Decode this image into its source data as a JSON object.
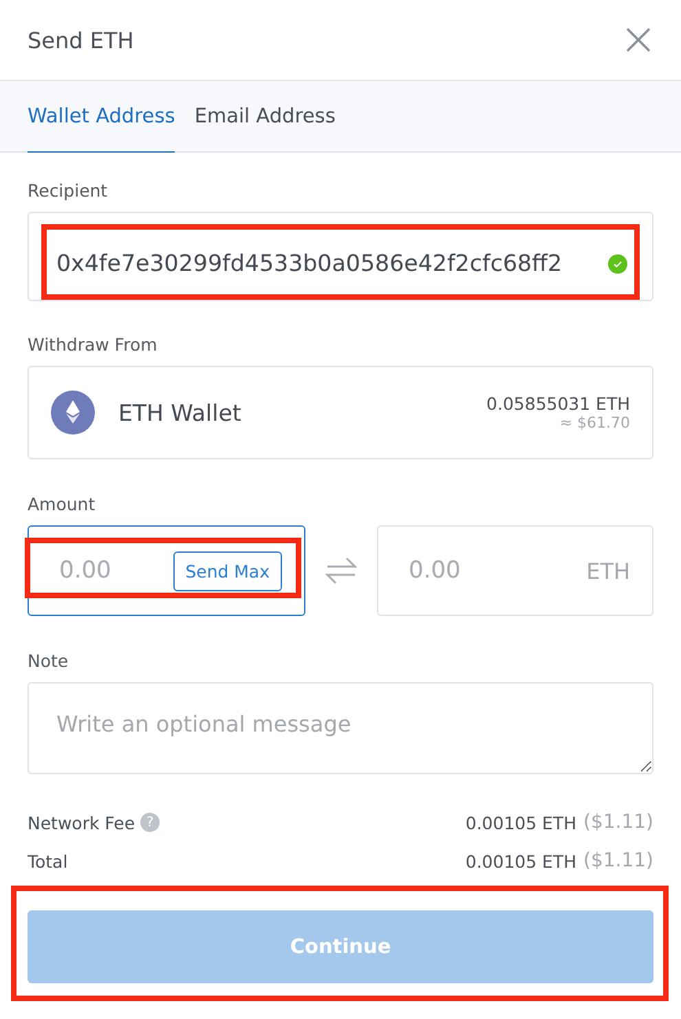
{
  "window": {
    "title": "Send ETH"
  },
  "tabs": [
    {
      "label": "Wallet Address",
      "selected": true
    },
    {
      "label": "Email Address",
      "selected": false
    }
  ],
  "recipient": {
    "label": "Recipient",
    "value": "0x4fe7e30299fd4533b0a0586e42f2cfc68ff2",
    "valid": true,
    "highlighted": true
  },
  "withdraw_from": {
    "label": "Withdraw From",
    "wallet": "ETH Wallet",
    "balance": "0.05855031 ETH",
    "fiat": "≈ $61.70"
  },
  "amount": {
    "label": "Amount",
    "placeholder": "0.00",
    "send_max": "Send Max",
    "highlighted": true,
    "converted_placeholder": "0.00",
    "unit": "ETH"
  },
  "note": {
    "label": "Note",
    "placeholder": "Write an optional message"
  },
  "summary": [
    {
      "label": "Network Fee",
      "help_icon": "?",
      "value": "0.00105 ETH",
      "fiat": "($1.11)"
    },
    {
      "label": "Total",
      "value": "0.00105 ETH",
      "fiat": "($1.11)"
    }
  ],
  "continue": {
    "label": "Continue",
    "disabled": true,
    "highlighted": true
  }
}
